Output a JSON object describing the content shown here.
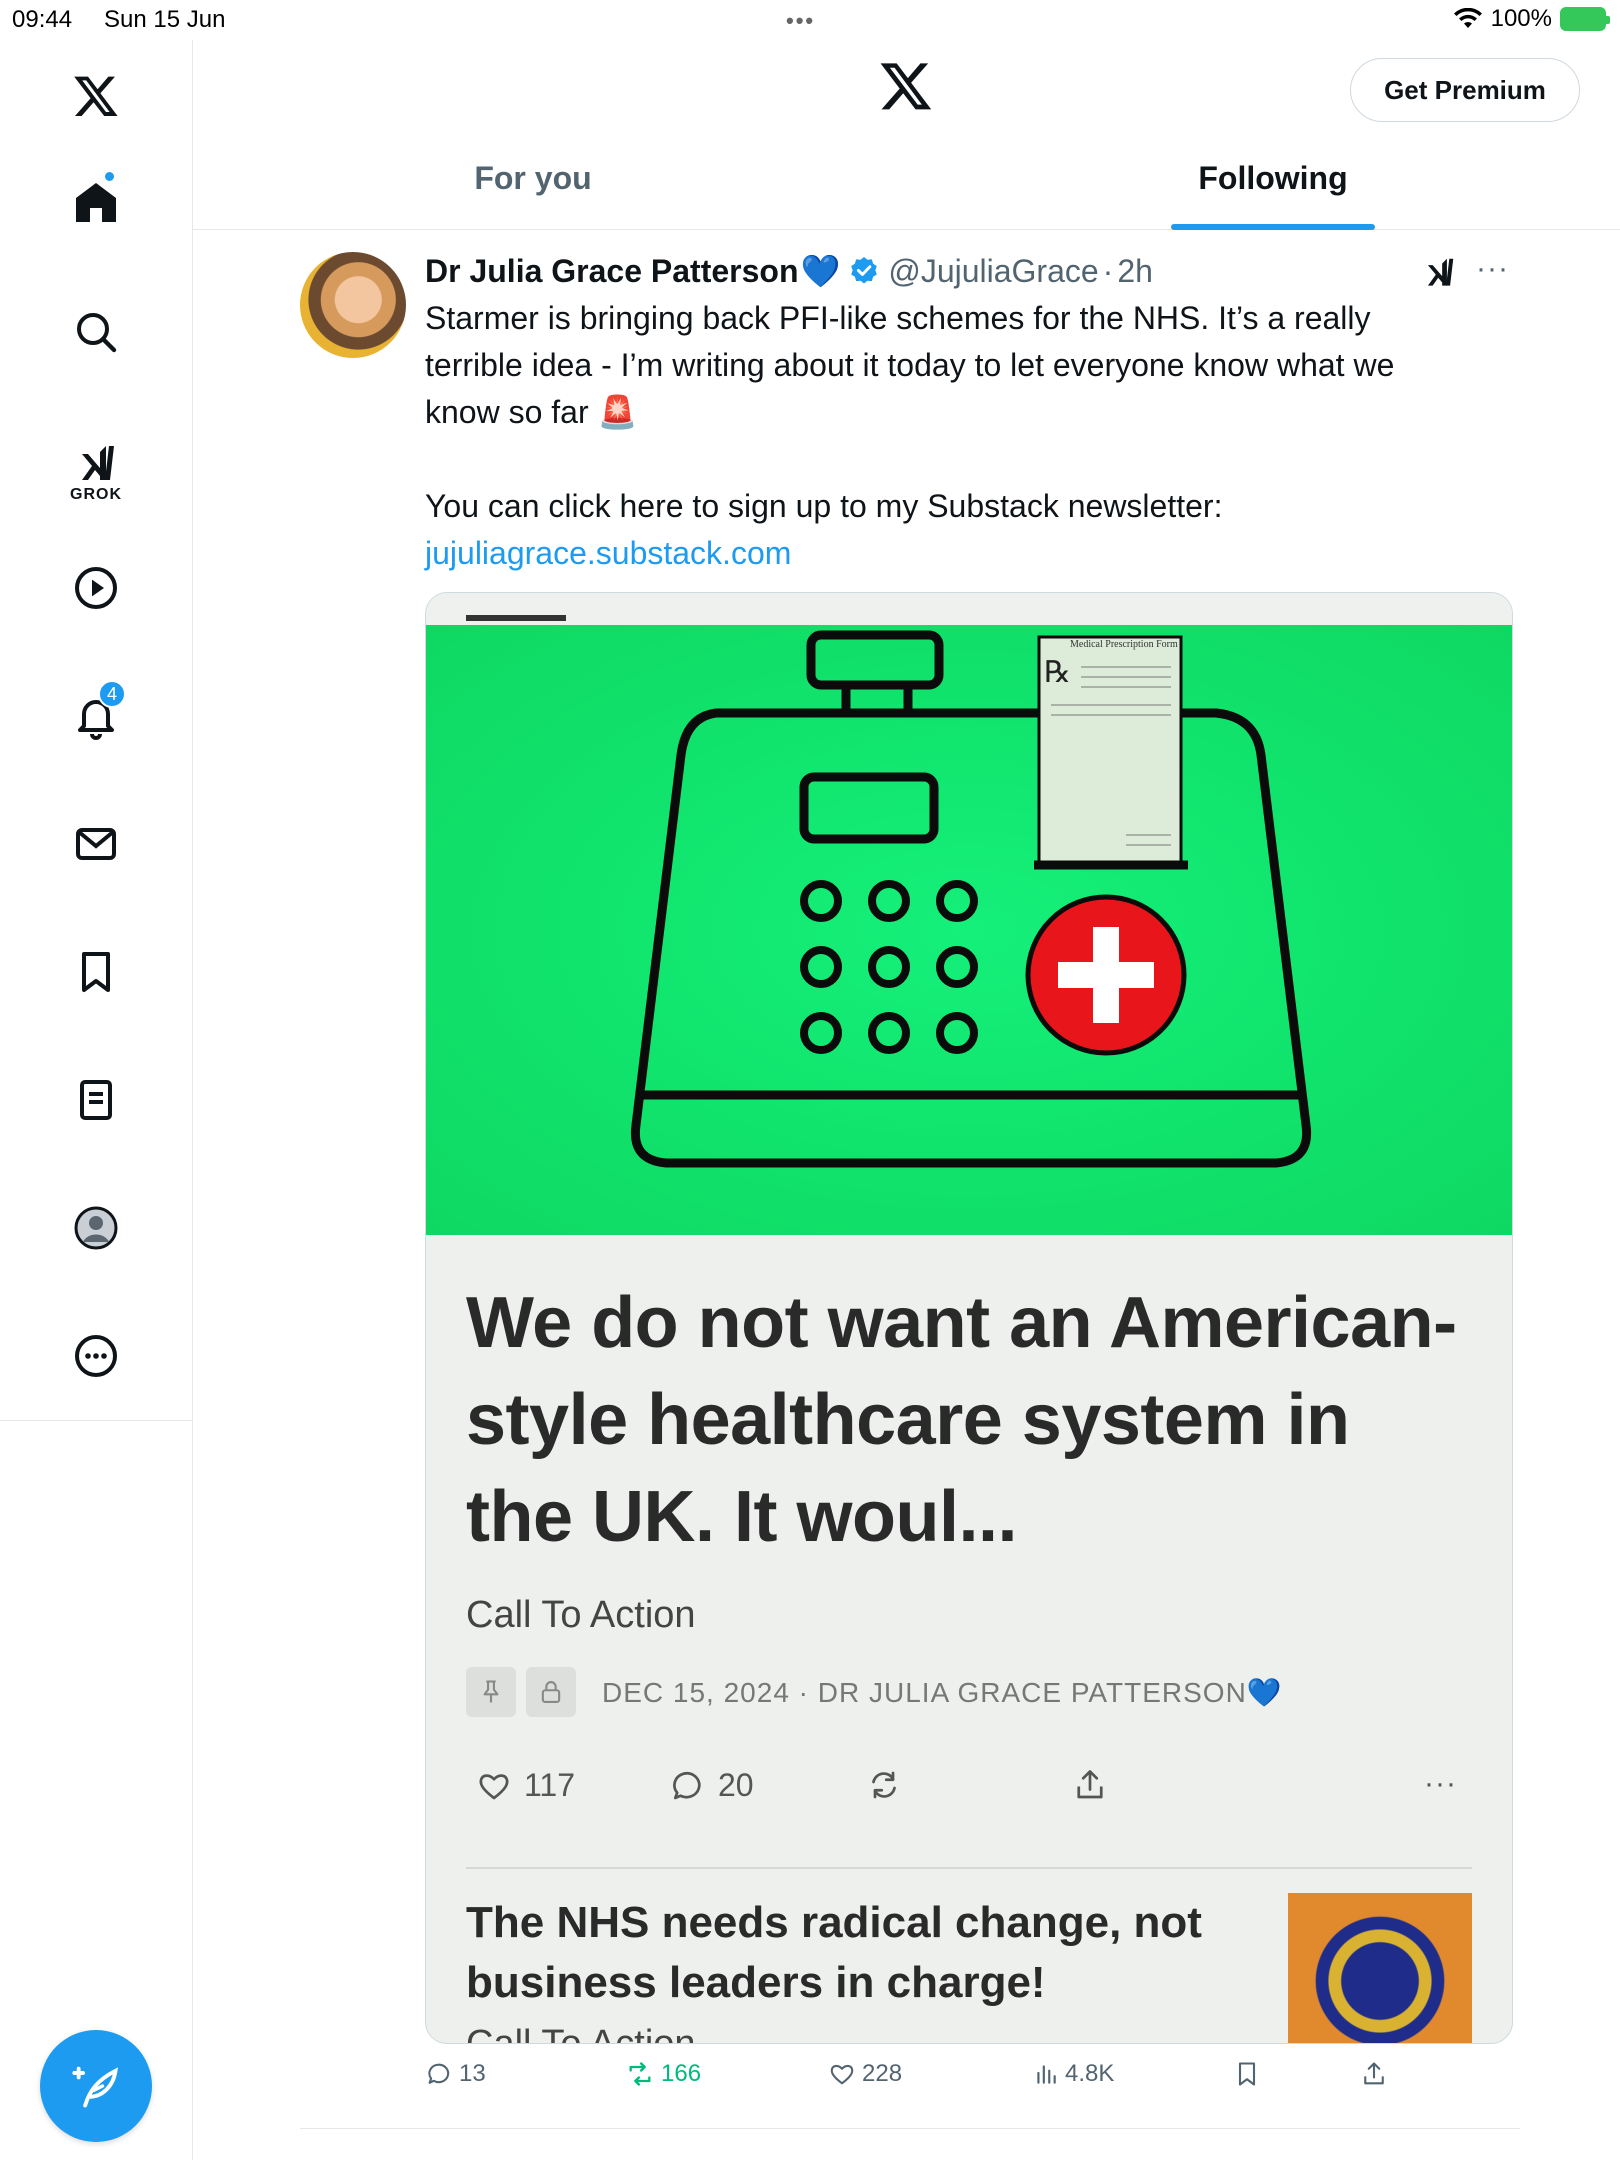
{
  "status_bar": {
    "time": "09:44",
    "date": "Sun 15 Jun",
    "battery": "100%"
  },
  "sidebar": {
    "grok_label": "GROK",
    "notifications_count": "4"
  },
  "header": {
    "premium_label": "Get Premium",
    "tabs": [
      {
        "label": "For you",
        "active": false
      },
      {
        "label": "Following",
        "active": true
      }
    ]
  },
  "tweet": {
    "author_name": "Dr Julia Grace Patterson",
    "name_emoji": "💙",
    "handle": "@JujuliaGrace",
    "separator": "·",
    "time": "2h",
    "text": "Starmer is bringing back PFI-like schemes for the NHS. It’s a really terrible idea - I’m writing about it today to let everyone know what we know so far 🚨\n\nYou can click here to sign up to my Substack newsletter:",
    "link": "jujuliagrace.substack.com",
    "stats": {
      "replies": "13",
      "reposts": "166",
      "likes": "228",
      "views": "4.8K"
    }
  },
  "card": {
    "headline": "We do not want an American-style healthcare system in the UK. It woul...",
    "subtitle": "Call To Action",
    "meta": "DEC 15, 2024 · DR JULIA GRACE PATTERSON💙",
    "likes": "117",
    "comments": "20",
    "prescription_title": "Medical Prescription Form",
    "prescription_rx": "℞",
    "next_title": "The NHS needs radical change, not business leaders in charge!",
    "next_subtitle": "Call To Action"
  },
  "colors": {
    "accent": "#1d9bf0",
    "repost_green": "#00ba7c",
    "card_green": "#10e36c",
    "red_cross": "#e8151b"
  }
}
